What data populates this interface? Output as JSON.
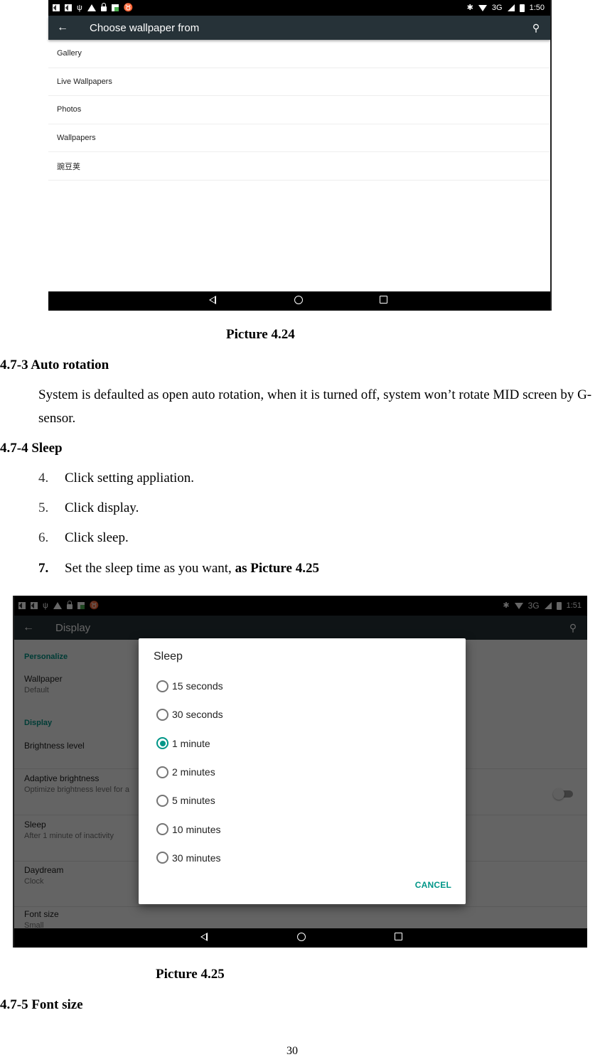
{
  "picture_4_24": {
    "status_bar": {
      "left_icons": [
        "screenshot-icon",
        "screenshot-icon",
        "usb-icon",
        "warning-icon",
        "lock-icon",
        "gallery-icon",
        "android-debug-icon"
      ],
      "right_icons": [
        "bluetooth-icon",
        "wifi-icon",
        "signal-icon",
        "battery-icon"
      ],
      "network": "3G",
      "time": "1:50"
    },
    "app_bar": {
      "back_icon": "←",
      "title": "Choose wallpaper from",
      "search_icon": "⚲"
    },
    "items": [
      {
        "label": "Gallery"
      },
      {
        "label": "Live Wallpapers"
      },
      {
        "label": "Photos"
      },
      {
        "label": "Wallpapers"
      },
      {
        "label": "豌豆荚"
      }
    ],
    "nav": [
      "back",
      "home",
      "recents"
    ]
  },
  "document": {
    "caption_1": "Picture 4.24",
    "section_3": {
      "heading": "4.7-3 Auto rotation",
      "paragraph": "System is defaulted as open auto rotation, when it is turned off, system won’t rotate MID screen by G-sensor."
    },
    "section_4": {
      "heading": "4.7-4 Sleep",
      "steps": [
        {
          "num": "4.",
          "text": "Click setting appliation."
        },
        {
          "num": "5.",
          "text": "Click display."
        },
        {
          "num": "6.",
          "text": "Click sleep."
        },
        {
          "num": "7.",
          "text": "Set the sleep time as you want, ",
          "bold_suffix": "as Picture 4.25"
        }
      ]
    },
    "caption_2": "Picture 4.25",
    "section_5": {
      "heading": "4.7-5 Font size"
    },
    "page_number": "30"
  },
  "picture_4_25": {
    "status_bar": {
      "network": "3G",
      "time": "1:51"
    },
    "app_bar": {
      "back_icon": "←",
      "title": "Display",
      "search_icon": "⚲"
    },
    "settings": {
      "section_personalize": "Personalize",
      "wallpaper": {
        "title": "Wallpaper",
        "summary": "Default"
      },
      "section_display": "Display",
      "brightness": {
        "title": "Brightness level"
      },
      "adaptive": {
        "title": "Adaptive brightness",
        "summary": "Optimize brightness level for a",
        "enabled": false
      },
      "sleep": {
        "title": "Sleep",
        "summary": "After 1 minute of inactivity"
      },
      "daydream": {
        "title": "Daydream",
        "summary": "Clock"
      },
      "font_size": {
        "title": "Font size",
        "summary": "Small"
      }
    },
    "dialog": {
      "title": "Sleep",
      "options": [
        {
          "label": "15 seconds",
          "checked": false
        },
        {
          "label": "30 seconds",
          "checked": false
        },
        {
          "label": "1 minute",
          "checked": true
        },
        {
          "label": "2 minutes",
          "checked": false
        },
        {
          "label": "5 minutes",
          "checked": false
        },
        {
          "label": "10 minutes",
          "checked": false
        },
        {
          "label": "30 minutes",
          "checked": false
        }
      ],
      "cancel_label": "CANCEL"
    },
    "accent_color": "#009688",
    "appbar_color": "#263238"
  }
}
